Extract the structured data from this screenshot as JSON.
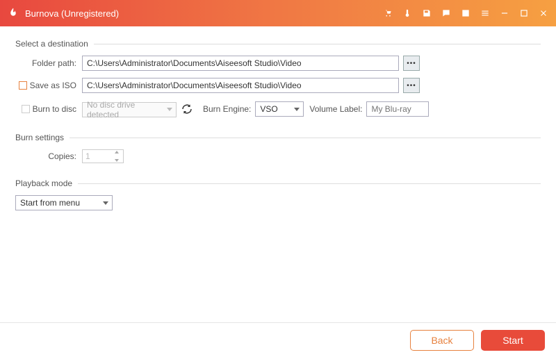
{
  "app": {
    "title": "Burnova (Unregistered)"
  },
  "sections": {
    "destination": {
      "legend": "Select a destination",
      "folder_label": "Folder path:",
      "folder_value": "C:\\Users\\Administrator\\Documents\\Aiseesoft Studio\\Video",
      "saveiso_label": "Save as ISO",
      "saveiso_value": "C:\\Users\\Administrator\\Documents\\Aiseesoft Studio\\Video",
      "burndisc_label": "Burn to disc",
      "drive_value": "No disc drive detected",
      "engine_label": "Burn Engine:",
      "engine_value": "VSO",
      "volume_label": "Volume Label:",
      "volume_placeholder": "My Blu-ray"
    },
    "burn": {
      "legend": "Burn settings",
      "copies_label": "Copies:",
      "copies_value": "1"
    },
    "playback": {
      "legend": "Playback mode",
      "mode_value": "Start from menu"
    }
  },
  "footer": {
    "back": "Back",
    "start": "Start"
  }
}
